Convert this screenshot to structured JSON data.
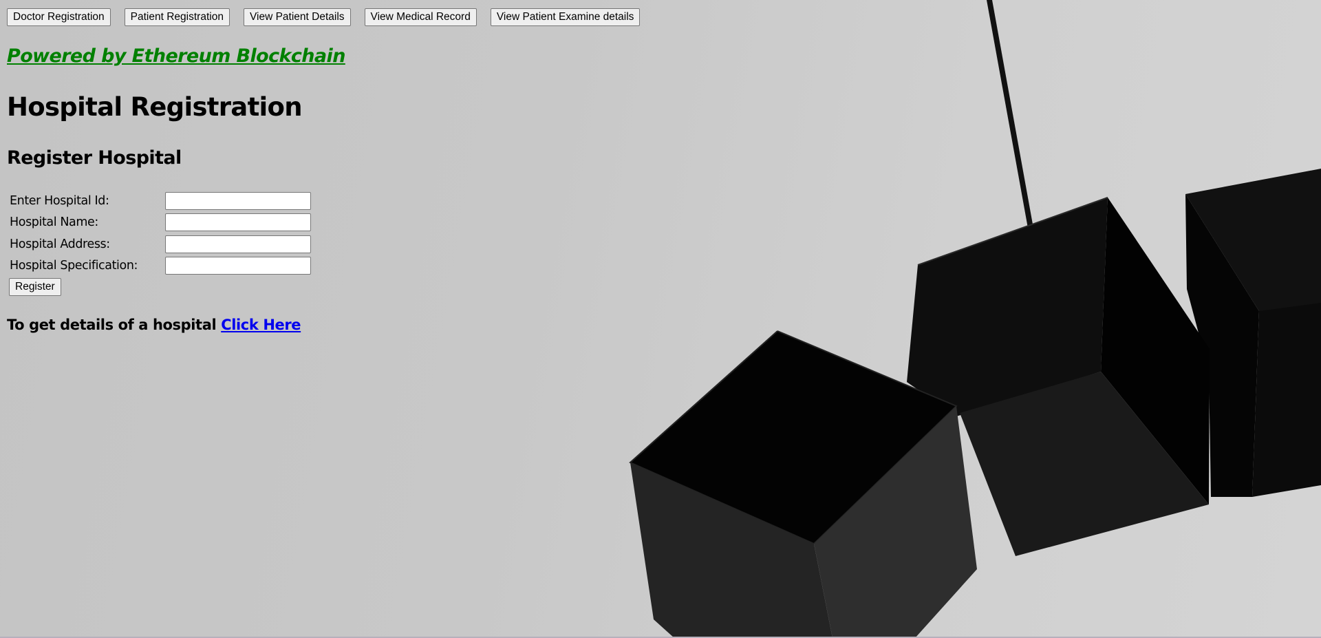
{
  "nav": {
    "buttons": [
      {
        "label": "Doctor Registration"
      },
      {
        "label": "Patient Registration"
      },
      {
        "label": "View Patient Details"
      },
      {
        "label": "View Medical Record"
      },
      {
        "label": "View Patient Examine details"
      }
    ]
  },
  "tagline": "Powered by Ethereum Blockchain",
  "page_title": "Hospital Registration",
  "section_title": "Register Hospital",
  "form": {
    "fields": [
      {
        "label": "Enter Hospital Id:",
        "value": "",
        "placeholder": ""
      },
      {
        "label": "Hospital Name:",
        "value": "",
        "placeholder": ""
      },
      {
        "label": "Hospital Address:",
        "value": "",
        "placeholder": ""
      },
      {
        "label": "Hospital Specification:",
        "value": "",
        "placeholder": ""
      }
    ],
    "submit_label": "Register"
  },
  "details": {
    "text": "To get details of a hospital",
    "link_label": "Click Here"
  },
  "colors": {
    "tagline": "#008000",
    "link": "#0000ee",
    "background": "#c8c8c8"
  },
  "background_image": {
    "description": "black geometric cube pendant lamps hanging on a cord against light grey"
  }
}
